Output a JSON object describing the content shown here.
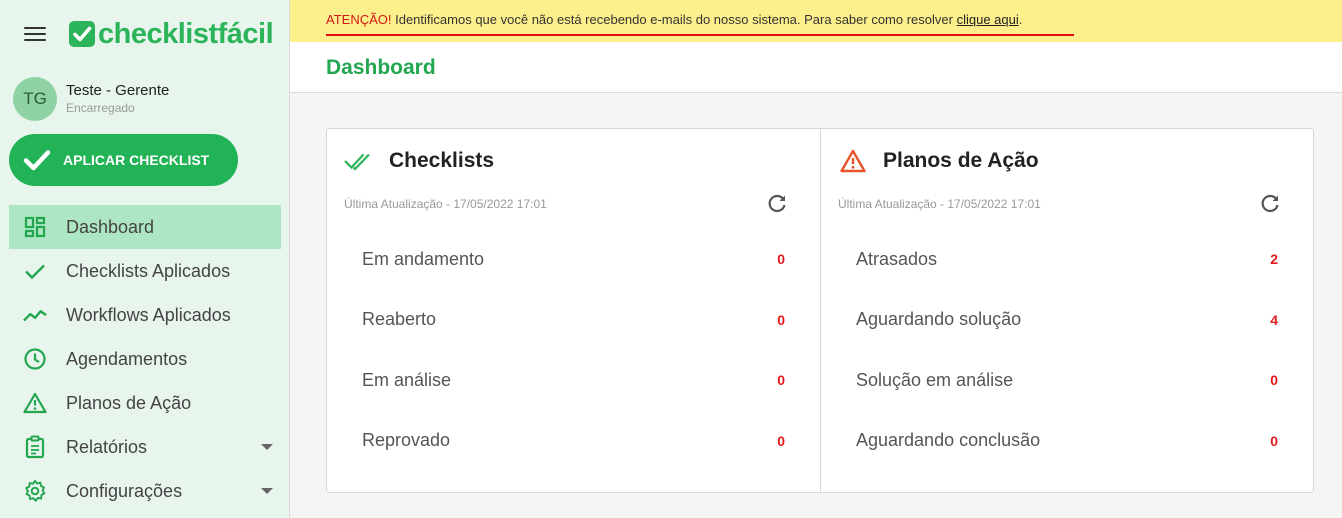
{
  "brand": {
    "name": "checklistfácil",
    "color": "#2bb45a"
  },
  "user": {
    "initials": "TG",
    "name": "Teste - Gerente",
    "role": "Encarregado"
  },
  "apply_button": {
    "label": "APLICAR CHECKLIST"
  },
  "nav": {
    "items": [
      {
        "label": "Dashboard",
        "icon": "dashboard-icon",
        "active": true
      },
      {
        "label": "Checklists Aplicados",
        "icon": "check-icon"
      },
      {
        "label": "Workflows Aplicados",
        "icon": "trending-icon"
      },
      {
        "label": "Agendamentos",
        "icon": "clock-icon"
      },
      {
        "label": "Planos de Ação",
        "icon": "warning-icon"
      },
      {
        "label": "Relatórios",
        "icon": "clipboard-icon",
        "expandable": true
      },
      {
        "label": "Configurações",
        "icon": "gear-icon",
        "expandable": true
      }
    ]
  },
  "banner": {
    "prefix": "ATENÇÃO!",
    "message": " Identificamos que você não está recebendo e-mails do nosso sistema. Para saber como resolver ",
    "link": "clique aqui",
    "suffix": "."
  },
  "page": {
    "title": "Dashboard"
  },
  "checklists_card": {
    "title": "Checklists",
    "updated": "Última Atualização - 17/05/2022 17:01",
    "rows": [
      {
        "label": "Em andamento",
        "value": "0"
      },
      {
        "label": "Reaberto",
        "value": "0"
      },
      {
        "label": "Em análise",
        "value": "0"
      },
      {
        "label": "Reprovado",
        "value": "0"
      }
    ]
  },
  "plans_card": {
    "title": "Planos de Ação",
    "updated": "Última Atualização - 17/05/2022 17:01",
    "rows": [
      {
        "label": "Atrasados",
        "value": "2"
      },
      {
        "label": "Aguardando solução",
        "value": "4"
      },
      {
        "label": "Solução em análise",
        "value": "0"
      },
      {
        "label": "Aguardando conclusão",
        "value": "0"
      }
    ]
  },
  "colors": {
    "accent": "#22b357",
    "alert": "#e01a1a",
    "banner": "#fdef8b",
    "warning_icon": "#e8542a"
  }
}
